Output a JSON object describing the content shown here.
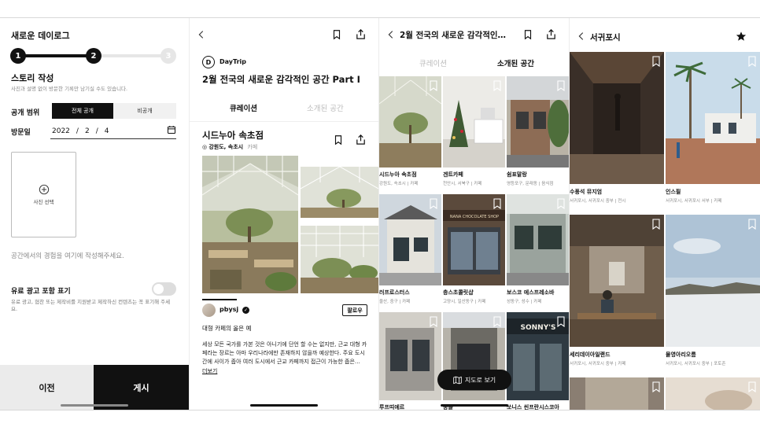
{
  "screen1": {
    "title": "새로운 데이로그",
    "steps": [
      "1",
      "2",
      "3"
    ],
    "heading": "스토리 작성",
    "subtitle": "사진과 설명 없이 방문한 기록만 남기실 수도 있습니다.",
    "visibility_label": "공개 범위",
    "visibility_options": [
      "전체 공개",
      "비공개"
    ],
    "visit_label": "방문일",
    "date": {
      "year": "2022",
      "month": "2",
      "day": "4"
    },
    "date_sep": "/",
    "photo_label": "사진 선택",
    "experience_placeholder": "공간에서의 경험을 여기에 작성해주세요.",
    "ad_label": "유료 광고 포함 표기",
    "ad_desc": "유료 광고, 협찬 또는 제작비를 지원받고 제작하신 컨텐츠는 꼭 표기해 주세요.",
    "prev_button": "이전",
    "post_button": "게시"
  },
  "screen2": {
    "brand_logo_letter": "D",
    "brand": "DayTrip",
    "title": "2월 전국의 새로운 감각적인 공간 Part I",
    "tabs": [
      "큐레이션",
      "소개된 공간"
    ],
    "place": "시드누아 속초점",
    "location": "강원도, 속초시",
    "category": "카페",
    "author": "pbysj",
    "follow": "팔로우",
    "post_title": "대형 카페의 올은 예",
    "post_body": "세상 모든 국가를 가본 것은 아니기에 단언 할 수는 없지만, 근교 대형 카페라는 장르는 아마 우리나라에만 존재하지 않을까 예상한다. 주요 도시간에 사이가 좁아 여러 도시에서 근교 카페까지 접근이 가능한 좁은…",
    "more": "더보기"
  },
  "screen3": {
    "title": "2월 전국의 새로운 감각적인…",
    "tabs": [
      "큐레이션",
      "소개된 공간"
    ],
    "items": [
      {
        "name": "시드누아 속초점",
        "sub": "강원도, 속초시 | 카페"
      },
      {
        "name": "겐트카페",
        "sub": "천안시, 서북구 | 카페"
      },
      {
        "name": "쉼표말랑",
        "sub": "영등포구, 문래동 | 음식점"
      },
      {
        "name": "러프로스터스",
        "sub": "울산, 중구 | 카페"
      },
      {
        "name": "층스초콜릿샵",
        "sub": "고양시, 일산동구 | 카페"
      },
      {
        "name": "보스코 에스프레소바",
        "sub": "성동구, 성수 | 카페"
      },
      {
        "name": "루프띠에르",
        "sub": ""
      },
      {
        "name": "송돌",
        "sub": ""
      },
      {
        "name": "쏘니스 씬프란시스코아",
        "sub": ""
      }
    ],
    "sign_text": "NANA CHOCOLATE SHOP",
    "sonny_sign": "SONNY'S",
    "map_button": "지도로 보기"
  },
  "screen4": {
    "title": "서귀포시",
    "items": [
      {
        "name": "수풍석 뮤지엄",
        "sub": "서귀포시, 서귀포시 중부 | 전시"
      },
      {
        "name": "인스필",
        "sub": "서귀포시, 서귀포시 서부 | 카페"
      },
      {
        "name": "세리데이아일랜드",
        "sub": "서귀포시, 서귀포시 중부 | 카페"
      },
      {
        "name": "물영아리오름",
        "sub": "서귀포시, 서귀포시 중부 | 포토존"
      }
    ]
  },
  "colors": {
    "accent": "#111111",
    "muted": "#888888",
    "track": "#e6e6e6"
  }
}
